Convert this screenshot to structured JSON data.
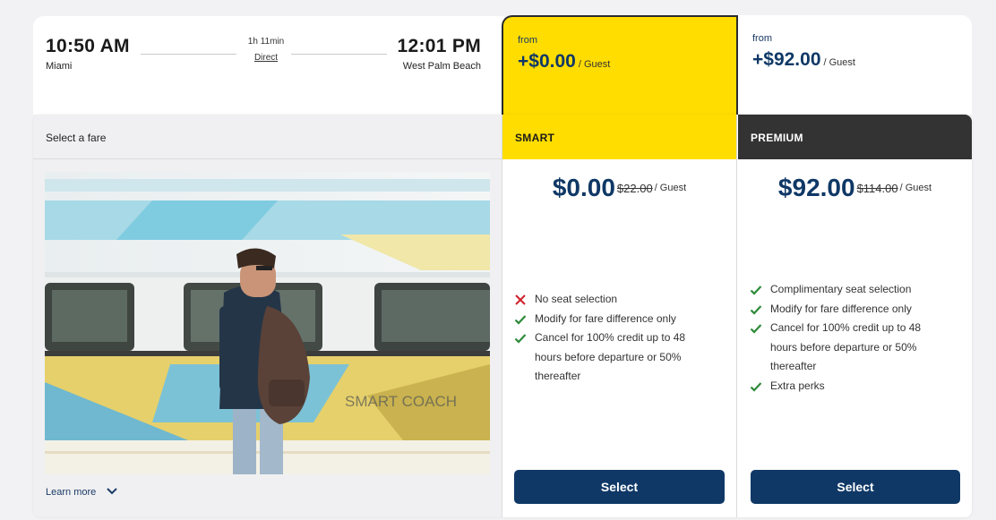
{
  "trip": {
    "depart_time": "10:50 AM",
    "depart_city": "Miami",
    "duration": "1h 11min",
    "stops": "Direct",
    "arrive_time": "12:01 PM",
    "arrive_city": "West Palm Beach"
  },
  "from_prices": {
    "smart": {
      "label": "from",
      "price": "+$0.00",
      "unit": "/ Guest"
    },
    "premium": {
      "label": "from",
      "price": "+$92.00",
      "unit": "/ Guest"
    }
  },
  "fare_panel": {
    "heading": "Select a fare",
    "learn_more": "Learn more",
    "image_lettering": "SMART COACH"
  },
  "fares": {
    "smart": {
      "name": "SMART",
      "price": "$0.00",
      "old_price": "$22.00",
      "unit": "/ Guest",
      "features": [
        {
          "icon": "x-icon",
          "text": "No seat selection",
          "included": false
        },
        {
          "icon": "check-icon",
          "text": "Modify for fare difference only",
          "included": true
        },
        {
          "icon": "check-icon",
          "text": "Cancel for 100% credit up to 48 hours before departure or 50% thereafter",
          "included": true
        }
      ],
      "select_label": "Select"
    },
    "premium": {
      "name": "PREMIUM",
      "price": "$92.00",
      "old_price": "$114.00",
      "unit": "/ Guest",
      "features": [
        {
          "icon": "check-icon",
          "text": "Complimentary seat selection",
          "included": true
        },
        {
          "icon": "check-icon",
          "text": "Modify for fare difference only",
          "included": true
        },
        {
          "icon": "check-icon",
          "text": "Cancel for 100% credit up to 48 hours before departure or 50% thereafter",
          "included": true
        },
        {
          "icon": "check-icon",
          "text": "Extra perks",
          "included": true
        }
      ],
      "select_label": "Select"
    }
  },
  "colors": {
    "smart_yellow": "#ffdd00",
    "premium_dark": "#333333",
    "navy": "#0f3866",
    "check_green": "#2e8b3a",
    "cross_red": "#d0202a"
  }
}
